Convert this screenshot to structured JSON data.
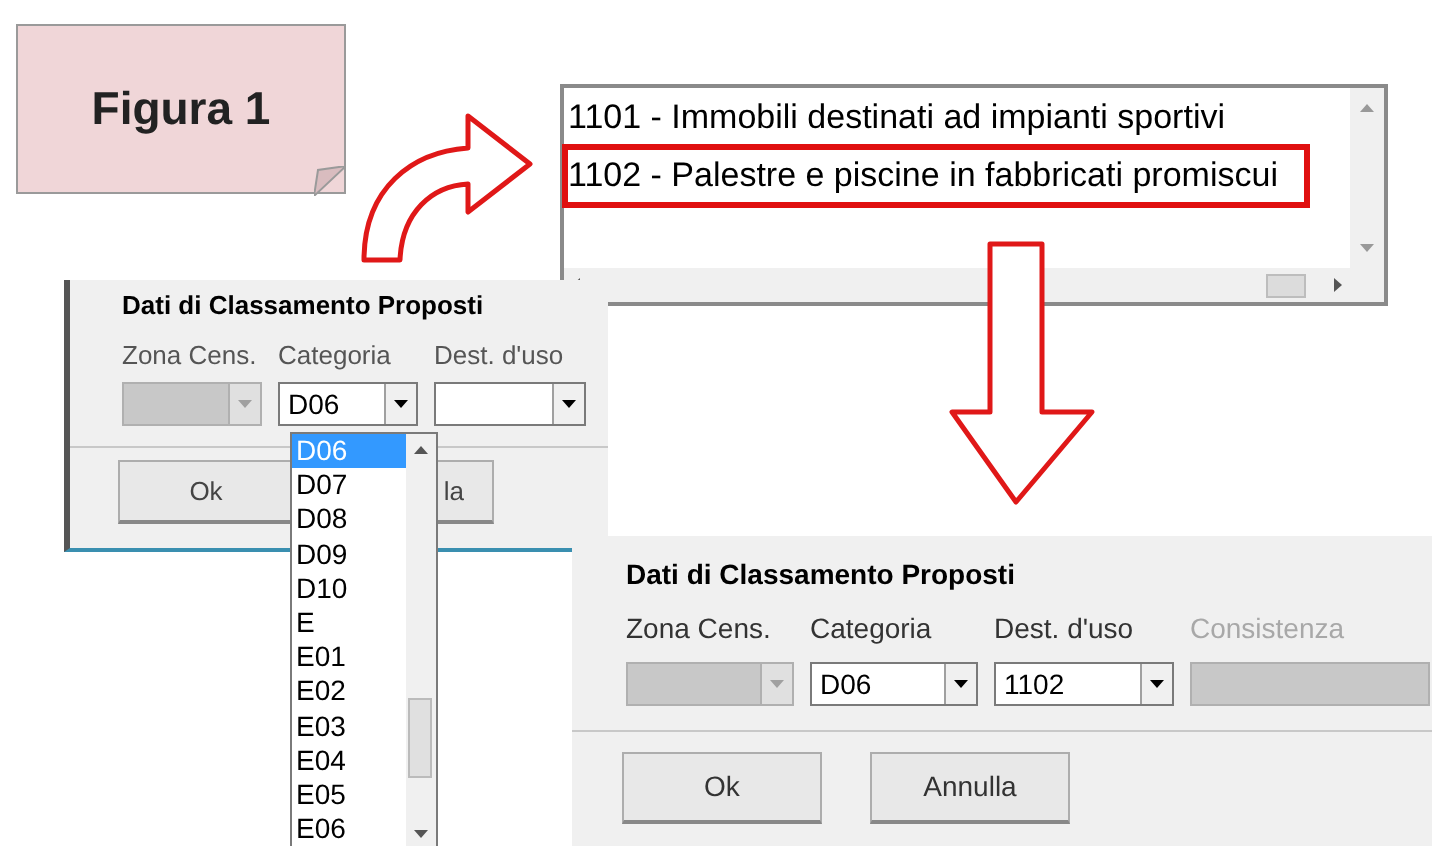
{
  "figure_label": "Figura 1",
  "list_box": {
    "items": [
      {
        "text": "1101 - Immobili destinati ad impianti sportivi",
        "highlighted": false
      },
      {
        "text": "1102 - Palestre e piscine in fabbricati promiscui",
        "highlighted": true
      }
    ]
  },
  "panel_before": {
    "title": "Dati di Classamento Proposti",
    "fields": [
      {
        "label": "Zona Cens.",
        "kind": "combo",
        "disabled": true,
        "label_dimmed": false
      },
      {
        "label": "Categoria",
        "kind": "combo",
        "disabled": false,
        "label_dimmed": false,
        "value": "D06"
      },
      {
        "label": "Dest. d'uso",
        "kind": "combo",
        "disabled": false,
        "label_dimmed": false
      }
    ],
    "buttons": [
      "Ok",
      "la"
    ],
    "dropdown": {
      "items": [
        {
          "text": "D06",
          "selected": true
        },
        {
          "text": "D07",
          "selected": false
        },
        {
          "text": "D08",
          "selected": false
        },
        {
          "text": "D09",
          "selected": false
        },
        {
          "text": "D10",
          "selected": false
        },
        {
          "text": "E",
          "selected": false
        },
        {
          "text": "E01",
          "selected": false
        },
        {
          "text": "E02",
          "selected": false
        },
        {
          "text": "E03",
          "selected": false
        },
        {
          "text": "E04",
          "selected": false
        },
        {
          "text": "E05",
          "selected": false
        },
        {
          "text": "E06",
          "selected": false
        }
      ]
    }
  },
  "panel_after": {
    "title": "Dati di Classamento Proposti",
    "fields": [
      {
        "label": "Zona Cens.",
        "kind": "combo",
        "disabled": true,
        "label_dimmed": false
      },
      {
        "label": "Categoria",
        "kind": "combo",
        "disabled": false,
        "label_dimmed": false,
        "value": "D06"
      },
      {
        "label": "Dest. d'uso",
        "kind": "combo",
        "disabled": false,
        "label_dimmed": false,
        "value": "1102"
      },
      {
        "label": "Consistenza",
        "kind": "text",
        "disabled": true,
        "label_dimmed": true
      }
    ],
    "buttons": [
      "Ok",
      "Annulla"
    ]
  }
}
